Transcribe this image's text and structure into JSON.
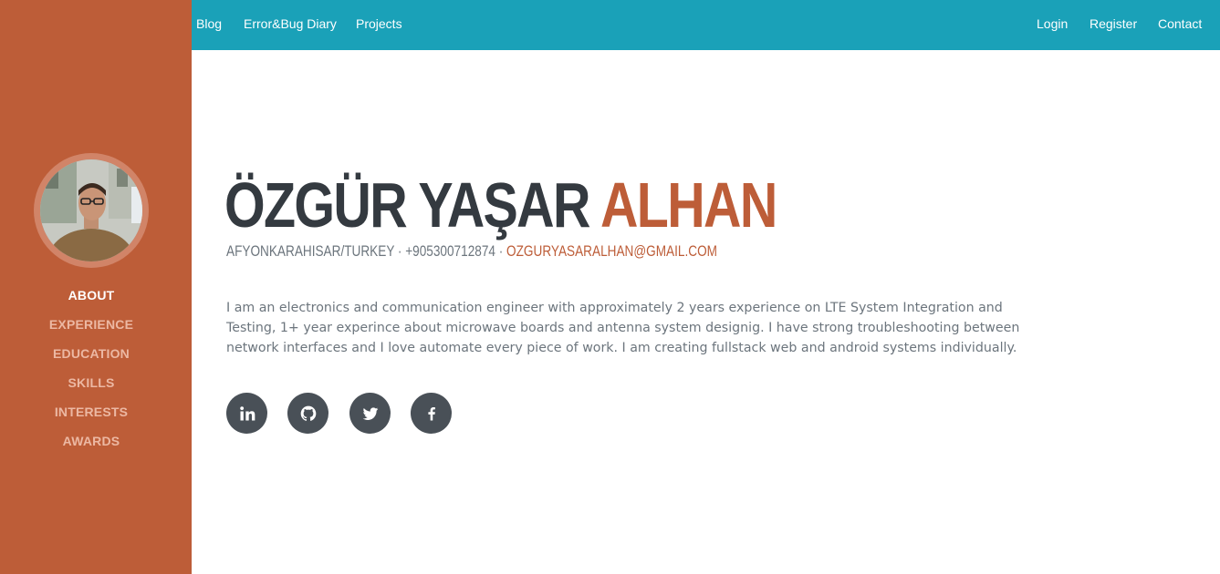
{
  "topnav": {
    "left_links": [
      "Blog",
      "Error&Bug Diary",
      "Projects"
    ],
    "right_links": [
      "Login",
      "Register",
      "Contact"
    ]
  },
  "sidebar": {
    "items": [
      {
        "label": "ABOUT",
        "active": true
      },
      {
        "label": "EXPERIENCE",
        "active": false
      },
      {
        "label": "EDUCATION",
        "active": false
      },
      {
        "label": "SKILLS",
        "active": false
      },
      {
        "label": "INTERESTS",
        "active": false
      },
      {
        "label": "AWARDS",
        "active": false
      }
    ]
  },
  "profile": {
    "first_names": "ÖZGÜR YAŞAR",
    "last_name": "ALHAN",
    "location": "AFYONKARAHISAR/TURKEY",
    "separator": " · ",
    "phone": "+905300712874",
    "email": "OZGURYASARALHAN@GMAIL.COM",
    "bio": "I am an electronics and communication engineer with approximately 2 years experience on LTE System Integration and Testing, 1+ year experince about microwave boards and antenna system designig. I have strong troubleshooting between network interfaces and I love automate every piece of work. I am creating fullstack web and android systems individually."
  },
  "social": [
    {
      "icon": "linkedin-icon"
    },
    {
      "icon": "github-icon"
    },
    {
      "icon": "twitter-icon"
    },
    {
      "icon": "facebook-icon"
    }
  ],
  "colors": {
    "sidebar": "#bd5d38",
    "topbar": "#1aa1b8",
    "heading": "#343a40",
    "accent": "#bd5d38",
    "text_muted": "#6c757d",
    "social_bg": "#495057"
  }
}
